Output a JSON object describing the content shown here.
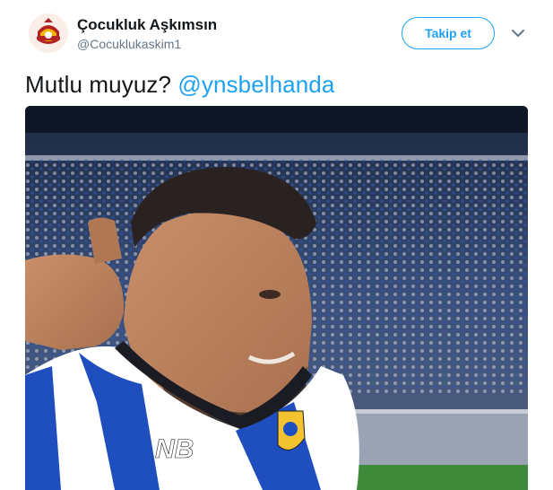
{
  "tweet": {
    "display_name": "Çocukluk Aşkımsın",
    "handle": "@Cocuklukaskim1",
    "follow_label": "Takip et",
    "text": "Mutlu muyuz?",
    "mention": "@ynsbelhanda",
    "media": {
      "kit_brand_logo": "new-balance-logo",
      "crest": "fc-porto-crest"
    }
  },
  "colors": {
    "accent": "#1da1f2",
    "text_primary": "#14171a",
    "text_secondary": "#657786"
  },
  "icons": {
    "avatar": "club-emblem-avatar",
    "menu": "chevron-down-icon"
  }
}
